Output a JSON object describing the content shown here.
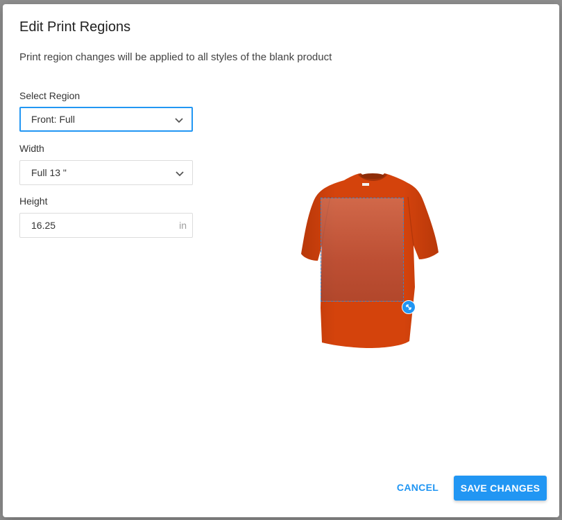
{
  "dialog": {
    "title": "Edit Print Regions",
    "subtitle": "Print region changes will be applied to all styles of the blank product"
  },
  "region": {
    "label": "Select Region",
    "value": "Front: Full"
  },
  "width": {
    "label": "Width",
    "value": "Full 13 \""
  },
  "height": {
    "label": "Height",
    "value": "16.25",
    "unit": "in"
  },
  "preview": {
    "shirt_color": "#d4420c",
    "region_border_color": "#3d84c6"
  },
  "actions": {
    "cancel": "CANCEL",
    "save": "SAVE CHANGES"
  },
  "colors": {
    "accent": "#2196f3"
  }
}
